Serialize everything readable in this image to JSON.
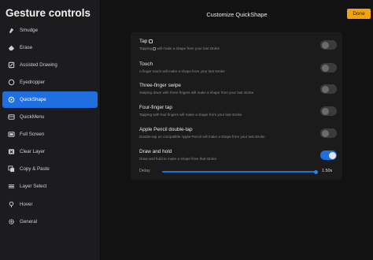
{
  "sidebar": {
    "title": "Gesture controls",
    "items": [
      {
        "label": "Smudge",
        "icon": "smudge-icon",
        "active": false
      },
      {
        "label": "Erase",
        "icon": "eraser-icon",
        "active": false
      },
      {
        "label": "Assisted Drawing",
        "icon": "assisted-drawing-icon",
        "active": false
      },
      {
        "label": "Eyedropper",
        "icon": "eyedropper-icon",
        "active": false
      },
      {
        "label": "QuickShape",
        "icon": "quickshape-icon",
        "active": true
      },
      {
        "label": "QuickMenu",
        "icon": "quickmenu-icon",
        "active": false
      },
      {
        "label": "Full Screen",
        "icon": "full-screen-icon",
        "active": false
      },
      {
        "label": "Clear Layer",
        "icon": "clear-layer-icon",
        "active": false
      },
      {
        "label": "Copy & Paste",
        "icon": "copy-paste-icon",
        "active": false
      },
      {
        "label": "Layer Select",
        "icon": "layer-select-icon",
        "active": false
      },
      {
        "label": "Hover",
        "icon": "hover-icon",
        "active": false
      },
      {
        "label": "General",
        "icon": "gear-icon",
        "active": false
      }
    ]
  },
  "header": {
    "title": "Customize QuickShape",
    "done_label": "Done"
  },
  "options": [
    {
      "title": "Tap",
      "desc_pre": "Tapping",
      "desc_post": "will make a shape from your last stroke",
      "enabled": false
    },
    {
      "title": "Touch",
      "desc": "A finger touch will make a shape from your last stroke",
      "enabled": false
    },
    {
      "title": "Three-finger swipe",
      "desc": "Swiping down with three fingers will make a shape from your last stroke",
      "enabled": false
    },
    {
      "title": "Four-finger tap",
      "desc": "Tapping with four fingers will make a shape from your last stroke",
      "enabled": false
    },
    {
      "title": "Apple Pencil double-tap",
      "desc": "Double-tap on compatible Apple Pencil will make a shape from your last stroke",
      "enabled": false
    },
    {
      "title": "Draw and hold",
      "desc": "Draw and hold to make a shape from that stroke",
      "enabled": true
    }
  ],
  "delay": {
    "label": "Delay",
    "value": "1.50s",
    "fraction": 1.0
  },
  "colors": {
    "accent": "#1f6fe0",
    "done_button": "#f0a30a"
  }
}
